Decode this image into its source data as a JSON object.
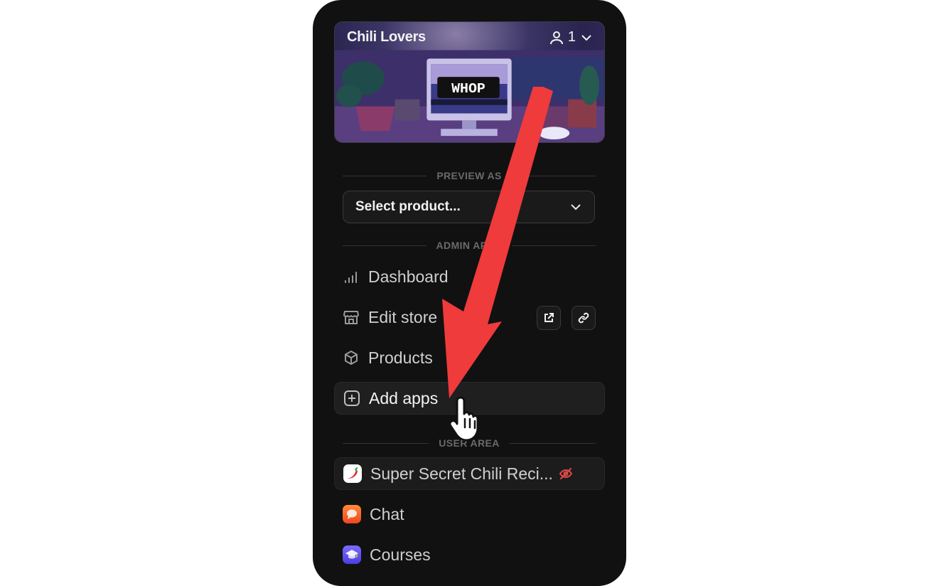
{
  "banner": {
    "title": "Chili Lovers",
    "member_count": "1",
    "image_text": "WHOP"
  },
  "preview": {
    "section_label": "PREVIEW AS",
    "select_value": "Select product..."
  },
  "admin": {
    "section_label": "ADMIN AREA",
    "items": [
      {
        "label": "Dashboard",
        "icon": "bar-chart-icon"
      },
      {
        "label": "Edit store",
        "icon": "store-icon"
      },
      {
        "label": "Products",
        "icon": "box-icon"
      },
      {
        "label": "Add apps",
        "icon": "plus-square-icon"
      }
    ]
  },
  "user": {
    "section_label": "USER AREA",
    "items": [
      {
        "label": "Super Secret Chili Reci...",
        "icon": "chili-pepper-icon",
        "status_icon": "eye-off-icon"
      },
      {
        "label": "Chat",
        "icon": "chat-bubble-icon"
      },
      {
        "label": "Courses",
        "icon": "graduation-cap-icon"
      }
    ]
  },
  "colors": {
    "panel_bg": "#111111",
    "annotation_arrow": "#ef3b3b",
    "hidden_status": "#e04848"
  }
}
